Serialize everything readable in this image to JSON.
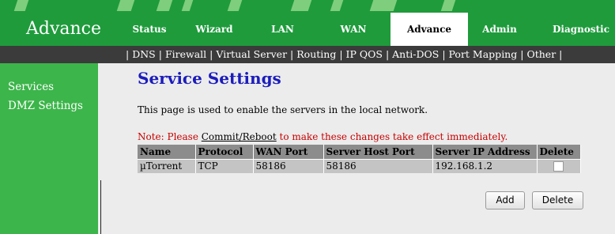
{
  "brand": "Advance",
  "nav": {
    "tabs": [
      {
        "label": "Status"
      },
      {
        "label": "Wizard"
      },
      {
        "label": "LAN"
      },
      {
        "label": "WAN"
      },
      {
        "label": "Advance",
        "active": true
      },
      {
        "label": "Admin"
      },
      {
        "label": "Diagnostic"
      }
    ]
  },
  "submenu": {
    "items": [
      "DNS",
      "Firewall",
      "Virtual Server",
      "Routing",
      "IP QOS",
      "Anti-DOS",
      "Port Mapping",
      "Other"
    ],
    "separator": "|"
  },
  "sidebar": {
    "items": [
      {
        "label": "Services"
      },
      {
        "label": "DMZ Settings"
      }
    ]
  },
  "main": {
    "title": "Service Settings",
    "description": "This page is used to enable the servers in the local network.",
    "note_prefix": "Note: Please ",
    "note_link": "Commit/Reboot",
    "note_suffix": " to make these changes take effect immediately."
  },
  "table": {
    "headers": [
      "Name",
      "Protocol",
      "WAN Port",
      "Server Host Port",
      "Server IP Address",
      "Delete"
    ],
    "rows": [
      {
        "name": "µTorrent",
        "protocol": "TCP",
        "wan_port": "58186",
        "host_port": "58186",
        "ip": "192.168.1.2",
        "delete_checked": false
      }
    ]
  },
  "buttons": {
    "add": "Add",
    "delete": "Delete"
  },
  "colors": {
    "header_green": "#1f9b3c",
    "sidebar_green": "#3cb54a",
    "title_blue": "#1c1cbc",
    "note_red": "#c80000"
  }
}
